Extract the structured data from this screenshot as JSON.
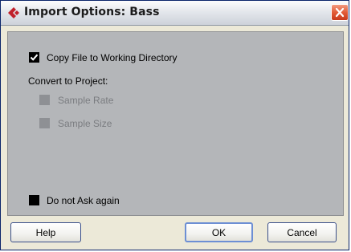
{
  "window": {
    "title": "Import Options: Bass",
    "app_icon": "cubase-logo-icon",
    "close_icon": "close-icon"
  },
  "options": {
    "copy_file": {
      "label": "Copy File to Working Directory",
      "checked": true
    },
    "convert_heading": "Convert to Project:",
    "sample_rate": {
      "label": "Sample Rate",
      "checked": false,
      "enabled": false
    },
    "sample_size": {
      "label": "Sample Size",
      "checked": false,
      "enabled": false
    },
    "do_not_ask": {
      "label": "Do not Ask again",
      "checked": false
    }
  },
  "buttons": {
    "help": "Help",
    "ok": "OK",
    "cancel": "Cancel"
  },
  "colors": {
    "panel": "#b4b6b9",
    "close": "#e25c37",
    "logo": "#c0202a"
  }
}
